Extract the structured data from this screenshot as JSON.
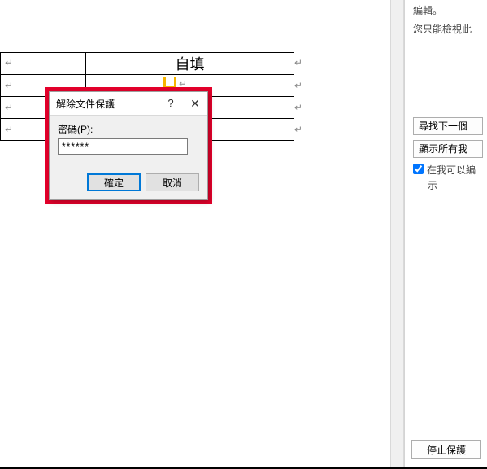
{
  "table": {
    "header": "自填"
  },
  "marks": {
    "enter": "↵"
  },
  "dialog": {
    "title": "解除文件保護",
    "help_symbol": "?",
    "close_symbol": "✕",
    "password_label": "密碼(P):",
    "password_value": "******",
    "ok_label": "確定",
    "cancel_label": "取消"
  },
  "panel": {
    "info_line1": "編輯。",
    "info_line2": "您只能檢視此",
    "btn_find_next": "尋找下一個",
    "btn_show_all": "顯示所有我",
    "checkbox_label": "在我可以編",
    "checkbox_sub": "示",
    "checkbox_checked": true,
    "btn_stop_protection": "停止保護"
  }
}
